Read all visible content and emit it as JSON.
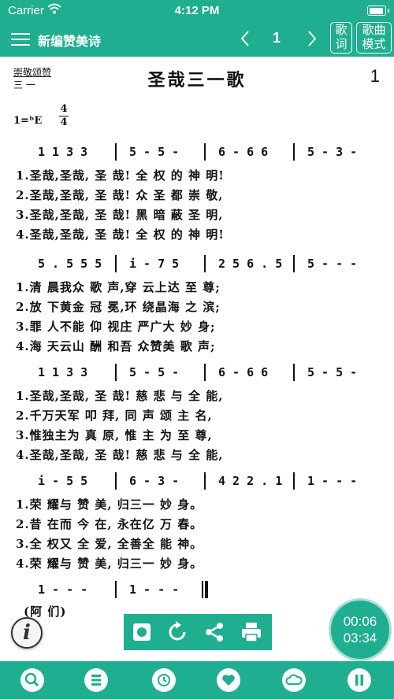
{
  "status": {
    "carrier": "Carrier",
    "time": "4:12 PM"
  },
  "header": {
    "title": "新编赞美诗",
    "page": "1",
    "lyrics_btn": "歌词",
    "mode_btn_line1": "歌曲",
    "mode_btn_line2": "模式"
  },
  "score": {
    "category_line1": "崇敬颂赞",
    "category_line2": "三 一",
    "title": "圣哉三一歌",
    "number": "1",
    "key": "1=ᵇE",
    "time_top": "4",
    "time_bottom": "4",
    "systems": [
      {
        "notes": [
          "1 1 3 3",
          "5 - 5 -",
          "6 - 6 6",
          "5 - 3 -"
        ],
        "lyrics": [
          "1.圣哉,圣哉, 圣 哉!  全 权 的 神 明!",
          "2.圣哉,圣哉, 圣 哉!  众 圣 都 崇 敬,",
          "3.圣哉,圣哉, 圣 哉!  黑 暗 蔽 圣 明,",
          "4.圣哉,圣哉, 圣 哉!  全 权 的 神 明!"
        ]
      },
      {
        "notes": [
          "5 . 5 5 5",
          "i - 7 5",
          "2 5 6 . 5",
          "5 - - -"
        ],
        "lyrics": [
          "1.清 晨我众 歌  声,穿  云上达 至  尊;",
          "2.放 下黄金 冠  冕,环  绕晶海 之  滨;",
          "3.罪 人不能 仰  视庄  严广大 妙  身;",
          "4.海 天云山 酬  和吾  众赞美 歌  声;"
        ]
      },
      {
        "notes": [
          "1 1 3 3",
          "5 - 5 -",
          "6 - 6 6",
          "5 - 5 -"
        ],
        "lyrics": [
          "1.圣哉,圣哉, 圣 哉!  慈 悲 与 全 能,",
          "2.千万天军  叩  拜,  同 声 颂 主 名,",
          "3.惟独主为  真  原,  惟  主 为 至 尊,",
          "4.圣哉,圣哉, 圣 哉!  慈 悲 与 全 能,"
        ]
      },
      {
        "notes": [
          "i - 5 5",
          "6 - 3 -",
          "4 2 2 . 1",
          "1 - - -"
        ],
        "lyrics": [
          "1.荣  耀与  赞 美,  归三一 妙  身。",
          "2.昔  在而  今 在,  永在亿 万  春。",
          "3.全  权又  全 爱,  全善全 能  神。",
          "4.荣  耀与  赞 美,  归三一 妙  身。"
        ]
      },
      {
        "notes": [
          "1 - - -",
          "1 - - -"
        ],
        "lyrics": [
          "(阿          们)"
        ]
      }
    ]
  },
  "timer": {
    "elapsed": "00:06",
    "total": "03:34"
  },
  "toolbar": {
    "record_icon": "record-icon",
    "replay_icon": "replay-icon",
    "share_icon": "share-icon",
    "print_icon": "print-icon"
  },
  "bottom_icons": [
    "search-icon",
    "list-icon",
    "history-icon",
    "heart-icon",
    "cloud-icon",
    "pause-icon"
  ],
  "colors": {
    "accent": "#1fae90"
  }
}
